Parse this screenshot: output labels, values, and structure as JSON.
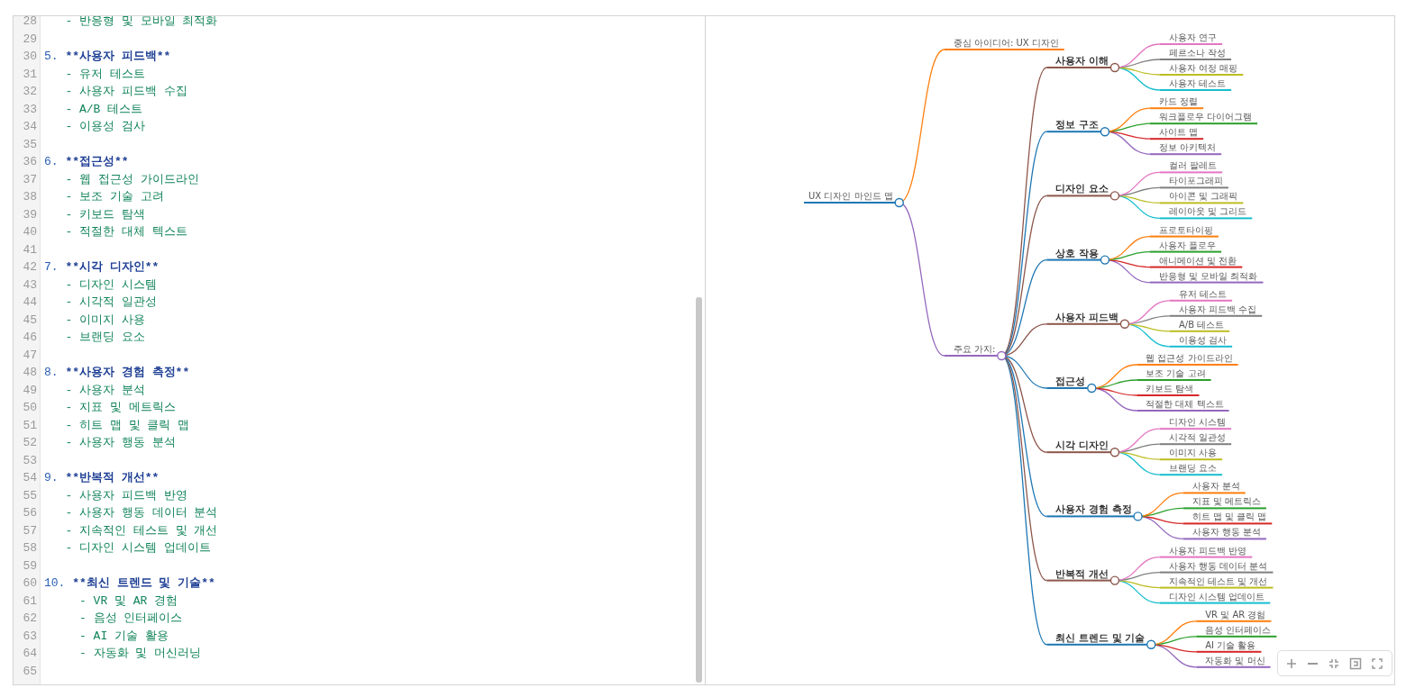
{
  "editor": {
    "lines": [
      {
        "number": "28",
        "kind": "item",
        "text": "   - 반응형 및 모바일 최적화"
      },
      {
        "number": "29",
        "kind": "blank"
      },
      {
        "number": "30",
        "kind": "heading",
        "marker": "5.",
        "title": "**사용자 피드백**"
      },
      {
        "number": "31",
        "kind": "item",
        "text": "   - 유저 테스트"
      },
      {
        "number": "32",
        "kind": "item",
        "text": "   - 사용자 피드백 수집"
      },
      {
        "number": "33",
        "kind": "item",
        "text": "   - A/B 테스트"
      },
      {
        "number": "34",
        "kind": "item",
        "text": "   - 이용성 검사"
      },
      {
        "number": "35",
        "kind": "blank"
      },
      {
        "number": "36",
        "kind": "heading",
        "marker": "6.",
        "title": "**접근성**"
      },
      {
        "number": "37",
        "kind": "item",
        "text": "   - 웹 접근성 가이드라인"
      },
      {
        "number": "38",
        "kind": "item",
        "text": "   - 보조 기술 고려"
      },
      {
        "number": "39",
        "kind": "item",
        "text": "   - 키보드 탐색"
      },
      {
        "number": "40",
        "kind": "item",
        "text": "   - 적절한 대체 텍스트"
      },
      {
        "number": "41",
        "kind": "blank"
      },
      {
        "number": "42",
        "kind": "heading",
        "marker": "7.",
        "title": "**시각 디자인**"
      },
      {
        "number": "43",
        "kind": "item",
        "text": "   - 디자인 시스템"
      },
      {
        "number": "44",
        "kind": "item",
        "text": "   - 시각적 일관성"
      },
      {
        "number": "45",
        "kind": "item",
        "text": "   - 이미지 사용"
      },
      {
        "number": "46",
        "kind": "item",
        "text": "   - 브랜딩 요소"
      },
      {
        "number": "47",
        "kind": "blank"
      },
      {
        "number": "48",
        "kind": "heading",
        "marker": "8.",
        "title": "**사용자 경험 측정**"
      },
      {
        "number": "49",
        "kind": "item",
        "text": "   - 사용자 분석"
      },
      {
        "number": "50",
        "kind": "item",
        "text": "   - 지표 및 메트릭스"
      },
      {
        "number": "51",
        "kind": "item",
        "text": "   - 히트 맵 및 클릭 맵"
      },
      {
        "number": "52",
        "kind": "item",
        "text": "   - 사용자 행동 분석"
      },
      {
        "number": "53",
        "kind": "blank"
      },
      {
        "number": "54",
        "kind": "heading",
        "marker": "9.",
        "title": "**반복적 개선**"
      },
      {
        "number": "55",
        "kind": "item",
        "text": "   - 사용자 피드백 반영"
      },
      {
        "number": "56",
        "kind": "item",
        "text": "   - 사용자 행동 데이터 분석"
      },
      {
        "number": "57",
        "kind": "item",
        "text": "   - 지속적인 테스트 및 개선"
      },
      {
        "number": "58",
        "kind": "item",
        "text": "   - 디자인 시스템 업데이트"
      },
      {
        "number": "59",
        "kind": "blank"
      },
      {
        "number": "60",
        "kind": "heading",
        "marker": "10.",
        "title": "**최신 트렌드 및 기술**"
      },
      {
        "number": "61",
        "kind": "item",
        "text": "     - VR 및 AR 경험"
      },
      {
        "number": "62",
        "kind": "item",
        "text": "     - 음성 인터페이스"
      },
      {
        "number": "63",
        "kind": "item",
        "text": "     - AI 기술 활용"
      },
      {
        "number": "64",
        "kind": "item",
        "text": "     - 자동화 및 머신러닝"
      },
      {
        "number": "65",
        "kind": "blank"
      }
    ]
  },
  "mindmap": {
    "root": {
      "label": "UX 디자인 마인드 맵",
      "color": "#1f77b4",
      "children": [
        {
          "label": "중심 아이디어: UX 디자인",
          "color": "#ff7f0e"
        },
        {
          "label": "주요 가지:",
          "color": "#9467bd",
          "children": [
            {
              "label": "사용자 이해",
              "color": "#8c564b",
              "children": [
                {
                  "label": "사용자 연구",
                  "color": "#e377c2"
                },
                {
                  "label": "페르소나 작성",
                  "color": "#7f7f7f"
                },
                {
                  "label": "사용자 여정 매핑",
                  "color": "#bcbd22"
                },
                {
                  "label": "사용자 테스트",
                  "color": "#17becf"
                }
              ]
            },
            {
              "label": "정보 구조",
              "color": "#1f77b4",
              "children": [
                {
                  "label": "카드 정렬",
                  "color": "#ff7f0e"
                },
                {
                  "label": "워크플로우 다이어그램",
                  "color": "#2ca02c"
                },
                {
                  "label": "사이트 맵",
                  "color": "#d62728"
                },
                {
                  "label": "정보 아키텍처",
                  "color": "#9467bd"
                }
              ]
            },
            {
              "label": "디자인 요소",
              "color": "#8c564b",
              "children": [
                {
                  "label": "컬러 팔레트",
                  "color": "#e377c2"
                },
                {
                  "label": "타이포그래피",
                  "color": "#7f7f7f"
                },
                {
                  "label": "아이콘 및 그래픽",
                  "color": "#bcbd22"
                },
                {
                  "label": "레이아웃 및 그리드",
                  "color": "#17becf"
                }
              ]
            },
            {
              "label": "상호 작용",
              "color": "#1f77b4",
              "children": [
                {
                  "label": "프로토타이핑",
                  "color": "#ff7f0e"
                },
                {
                  "label": "사용자 플로우",
                  "color": "#2ca02c"
                },
                {
                  "label": "애니메이션 및 전환",
                  "color": "#d62728"
                },
                {
                  "label": "반응형 및 모바일 최적화",
                  "color": "#9467bd"
                }
              ]
            },
            {
              "label": "사용자 피드백",
              "color": "#8c564b",
              "children": [
                {
                  "label": "유저 테스트",
                  "color": "#e377c2"
                },
                {
                  "label": "사용자 피드백 수집",
                  "color": "#7f7f7f"
                },
                {
                  "label": "A/B 테스트",
                  "color": "#bcbd22"
                },
                {
                  "label": "이용성 검사",
                  "color": "#17becf"
                }
              ]
            },
            {
              "label": "접근성",
              "color": "#1f77b4",
              "children": [
                {
                  "label": "웹 접근성 가이드라인",
                  "color": "#ff7f0e"
                },
                {
                  "label": "보조 기술 고려",
                  "color": "#2ca02c"
                },
                {
                  "label": "키보드 탐색",
                  "color": "#d62728"
                },
                {
                  "label": "적절한 대체 텍스트",
                  "color": "#9467bd"
                }
              ]
            },
            {
              "label": "시각 디자인",
              "color": "#8c564b",
              "children": [
                {
                  "label": "디자인 시스템",
                  "color": "#e377c2"
                },
                {
                  "label": "시각적 일관성",
                  "color": "#7f7f7f"
                },
                {
                  "label": "이미지 사용",
                  "color": "#bcbd22"
                },
                {
                  "label": "브랜딩 요소",
                  "color": "#17becf"
                }
              ]
            },
            {
              "label": "사용자 경험 측정",
              "color": "#1f77b4",
              "children": [
                {
                  "label": "사용자 분석",
                  "color": "#ff7f0e"
                },
                {
                  "label": "지표 및 메트릭스",
                  "color": "#2ca02c"
                },
                {
                  "label": "히트 맵 및 클릭 맵",
                  "color": "#d62728"
                },
                {
                  "label": "사용자 행동 분석",
                  "color": "#9467bd"
                }
              ]
            },
            {
              "label": "반복적 개선",
              "color": "#8c564b",
              "children": [
                {
                  "label": "사용자 피드백 반영",
                  "color": "#e377c2"
                },
                {
                  "label": "사용자 행동 데이터 분석",
                  "color": "#7f7f7f"
                },
                {
                  "label": "지속적인 테스트 및 개선",
                  "color": "#bcbd22"
                },
                {
                  "label": "디자인 시스템 업데이트",
                  "color": "#17becf"
                }
              ]
            },
            {
              "label": "최신 트렌드 및 기술",
              "color": "#1f77b4",
              "children": [
                {
                  "label": "VR 및 AR 경험",
                  "color": "#ff7f0e"
                },
                {
                  "label": "음성 인터페이스",
                  "color": "#2ca02c"
                },
                {
                  "label": "AI 기술 활용",
                  "color": "#d62728"
                },
                {
                  "label": "자동화 및 머신",
                  "color": "#9467bd"
                }
              ]
            }
          ]
        }
      ]
    }
  }
}
